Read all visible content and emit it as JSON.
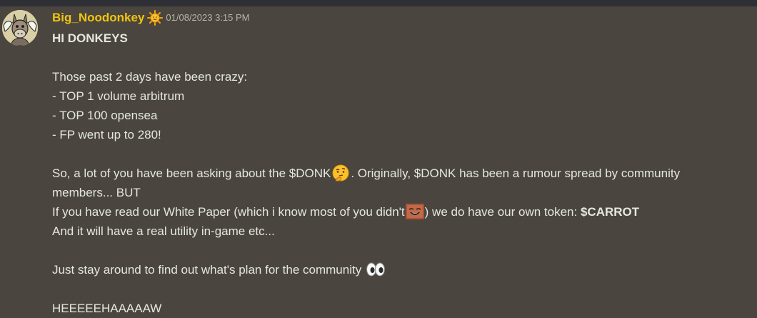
{
  "message": {
    "author": "Big_Noodonkey",
    "timestamp": "01/08/2023 3:15 PM",
    "badge_icon": "sun-icon",
    "avatar_icon": "donkey-avatar-icon",
    "author_color": "#f1c40f",
    "lines": {
      "l1": "HI DONKEYS",
      "l2": "Those past 2 days have been crazy:",
      "l3": "- TOP 1 volume arbitrum",
      "l4": "- TOP 100 opensea",
      "l5": "- FP went up to 280!",
      "l6a": "So, a lot of you have been asking about the $DONK",
      "l6b": ". Originally, $DONK has been a rumour spread by community",
      "l7": "members... BUT",
      "l8a": "If you have read our White Paper (which i know most of you didn't",
      "l8b": ") we do have our own token:",
      "l8c": "$CARROT",
      "l9": "And it will have a real utility in-game etc...",
      "l10": "Just stay around to find out what's plan for the community",
      "l11": "HEEEEEHAAAAAW"
    },
    "emojis": {
      "thinking": "thinking-face-emoji",
      "laughing": "laughing-man-emoji",
      "eyes": "eyes-emoji"
    }
  }
}
